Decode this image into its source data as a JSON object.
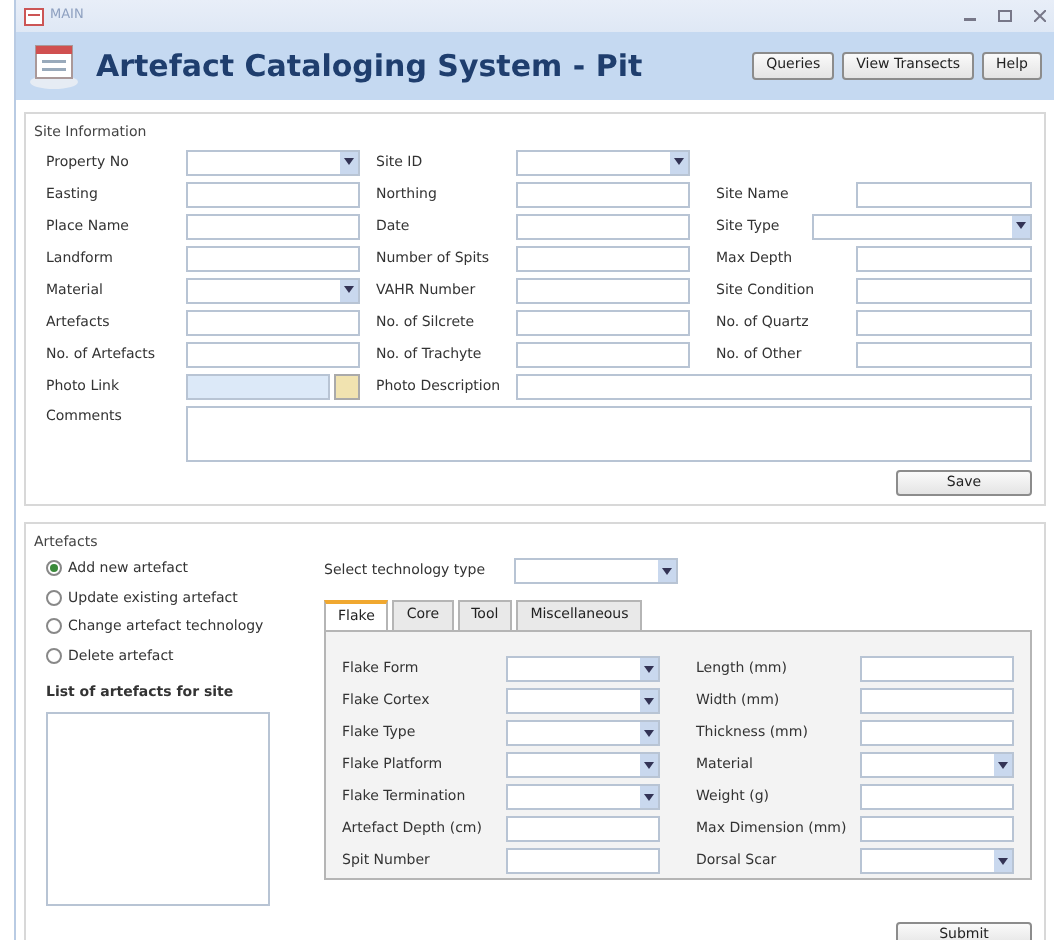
{
  "window": {
    "title": "MAIN"
  },
  "header": {
    "title": "Artefact Cataloging System - Pit",
    "buttons": [
      "Queries",
      "View Transects",
      "Help"
    ]
  },
  "site_information": {
    "legend": "Site Information",
    "rows": [
      [
        {
          "label": "Property No",
          "kind": "dropdown"
        },
        {
          "label": "Site ID",
          "kind": "dropdown"
        }
      ],
      [
        {
          "label": "Easting",
          "kind": "text"
        },
        {
          "label": "Northing",
          "kind": "text"
        },
        {
          "label": "Site Name",
          "kind": "text"
        }
      ],
      [
        {
          "label": "Place Name",
          "kind": "text"
        },
        {
          "label": "Date",
          "kind": "text"
        },
        {
          "label": "Site Type",
          "kind": "wide-dropdown"
        }
      ],
      [
        {
          "label": "Landform",
          "kind": "text"
        },
        {
          "label": "Number of Spits",
          "kind": "text"
        },
        {
          "label": "Max Depth",
          "kind": "text"
        }
      ],
      [
        {
          "label": "Material",
          "kind": "dropdown"
        },
        {
          "label": "VAHR Number",
          "kind": "text"
        },
        {
          "label": "Site Condition",
          "kind": "text"
        }
      ],
      [
        {
          "label": "Artefacts",
          "kind": "text"
        },
        {
          "label": "No. of Silcrete",
          "kind": "text"
        },
        {
          "label": "No. of Quartz",
          "kind": "text"
        }
      ],
      [
        {
          "label": "No. of Artefacts",
          "kind": "text"
        },
        {
          "label": "No. of Trachyte",
          "kind": "text"
        },
        {
          "label": "No. of Other",
          "kind": "text"
        }
      ],
      [
        {
          "label": "Photo Link",
          "kind": "browse"
        },
        {
          "label": "Photo Description",
          "kind": "long"
        }
      ],
      [
        {
          "label": "Comments",
          "kind": "memo"
        }
      ]
    ],
    "save_button": "Save"
  },
  "artefacts": {
    "legend": "Artefacts",
    "options": [
      {
        "label": "Add new artefact",
        "selected": true
      },
      {
        "label": "Update existing artefact",
        "selected": false
      },
      {
        "label": "Change artefact technology",
        "selected": false
      },
      {
        "label": "Delete artefact",
        "selected": false
      }
    ],
    "list_label": "List of artefacts for site",
    "technology_label": "Select technology type",
    "tabs": [
      {
        "label": "Flake",
        "selected": true
      },
      {
        "label": "Core",
        "selected": false
      },
      {
        "label": "Tool",
        "selected": false
      },
      {
        "label": "Miscellaneous",
        "selected": false
      }
    ],
    "left_fields": [
      {
        "label": "Flake Form",
        "kind": "dropdown"
      },
      {
        "label": "Flake Cortex",
        "kind": "dropdown"
      },
      {
        "label": "Flake Type",
        "kind": "dropdown"
      },
      {
        "label": "Flake Platform",
        "kind": "dropdown"
      },
      {
        "label": "Flake Termination",
        "kind": "dropdown"
      },
      {
        "label": "Artefact Depth (cm)",
        "kind": "text"
      },
      {
        "label": "Spit Number",
        "kind": "text"
      }
    ],
    "right_fields": [
      {
        "label": "Length (mm)",
        "kind": "text"
      },
      {
        "label": "Width (mm)",
        "kind": "text"
      },
      {
        "label": "Thickness (mm)",
        "kind": "text"
      },
      {
        "label": "Material",
        "kind": "dropdown"
      },
      {
        "label": "Weight (g)",
        "kind": "text"
      },
      {
        "label": "Max Dimension (mm)",
        "kind": "text"
      },
      {
        "label": "Dorsal Scar",
        "kind": "dropdown"
      }
    ],
    "submit_button": "Submit"
  }
}
